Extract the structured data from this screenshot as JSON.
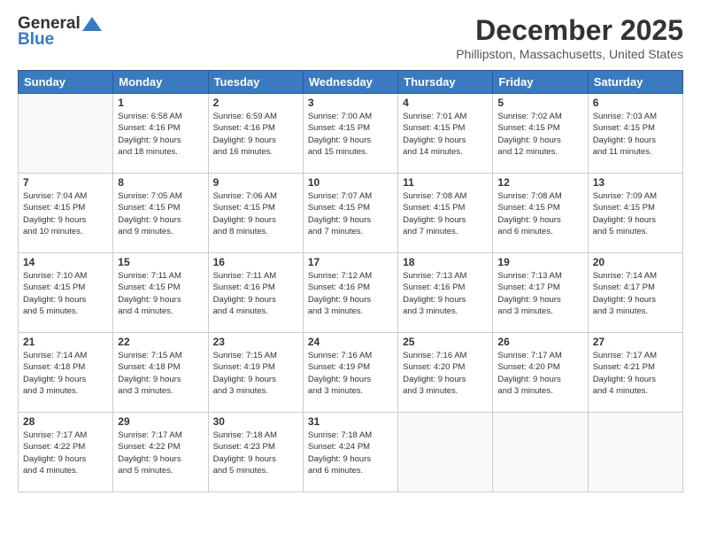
{
  "header": {
    "logo_general": "General",
    "logo_blue": "Blue",
    "month_title": "December 2025",
    "location": "Phillipston, Massachusetts, United States"
  },
  "weekdays": [
    "Sunday",
    "Monday",
    "Tuesday",
    "Wednesday",
    "Thursday",
    "Friday",
    "Saturday"
  ],
  "weeks": [
    [
      {
        "day": "",
        "info": ""
      },
      {
        "day": "1",
        "info": "Sunrise: 6:58 AM\nSunset: 4:16 PM\nDaylight: 9 hours\nand 18 minutes."
      },
      {
        "day": "2",
        "info": "Sunrise: 6:59 AM\nSunset: 4:16 PM\nDaylight: 9 hours\nand 16 minutes."
      },
      {
        "day": "3",
        "info": "Sunrise: 7:00 AM\nSunset: 4:15 PM\nDaylight: 9 hours\nand 15 minutes."
      },
      {
        "day": "4",
        "info": "Sunrise: 7:01 AM\nSunset: 4:15 PM\nDaylight: 9 hours\nand 14 minutes."
      },
      {
        "day": "5",
        "info": "Sunrise: 7:02 AM\nSunset: 4:15 PM\nDaylight: 9 hours\nand 12 minutes."
      },
      {
        "day": "6",
        "info": "Sunrise: 7:03 AM\nSunset: 4:15 PM\nDaylight: 9 hours\nand 11 minutes."
      }
    ],
    [
      {
        "day": "7",
        "info": "Sunrise: 7:04 AM\nSunset: 4:15 PM\nDaylight: 9 hours\nand 10 minutes."
      },
      {
        "day": "8",
        "info": "Sunrise: 7:05 AM\nSunset: 4:15 PM\nDaylight: 9 hours\nand 9 minutes."
      },
      {
        "day": "9",
        "info": "Sunrise: 7:06 AM\nSunset: 4:15 PM\nDaylight: 9 hours\nand 8 minutes."
      },
      {
        "day": "10",
        "info": "Sunrise: 7:07 AM\nSunset: 4:15 PM\nDaylight: 9 hours\nand 7 minutes."
      },
      {
        "day": "11",
        "info": "Sunrise: 7:08 AM\nSunset: 4:15 PM\nDaylight: 9 hours\nand 7 minutes."
      },
      {
        "day": "12",
        "info": "Sunrise: 7:08 AM\nSunset: 4:15 PM\nDaylight: 9 hours\nand 6 minutes."
      },
      {
        "day": "13",
        "info": "Sunrise: 7:09 AM\nSunset: 4:15 PM\nDaylight: 9 hours\nand 5 minutes."
      }
    ],
    [
      {
        "day": "14",
        "info": "Sunrise: 7:10 AM\nSunset: 4:15 PM\nDaylight: 9 hours\nand 5 minutes."
      },
      {
        "day": "15",
        "info": "Sunrise: 7:11 AM\nSunset: 4:15 PM\nDaylight: 9 hours\nand 4 minutes."
      },
      {
        "day": "16",
        "info": "Sunrise: 7:11 AM\nSunset: 4:16 PM\nDaylight: 9 hours\nand 4 minutes."
      },
      {
        "day": "17",
        "info": "Sunrise: 7:12 AM\nSunset: 4:16 PM\nDaylight: 9 hours\nand 3 minutes."
      },
      {
        "day": "18",
        "info": "Sunrise: 7:13 AM\nSunset: 4:16 PM\nDaylight: 9 hours\nand 3 minutes."
      },
      {
        "day": "19",
        "info": "Sunrise: 7:13 AM\nSunset: 4:17 PM\nDaylight: 9 hours\nand 3 minutes."
      },
      {
        "day": "20",
        "info": "Sunrise: 7:14 AM\nSunset: 4:17 PM\nDaylight: 9 hours\nand 3 minutes."
      }
    ],
    [
      {
        "day": "21",
        "info": "Sunrise: 7:14 AM\nSunset: 4:18 PM\nDaylight: 9 hours\nand 3 minutes."
      },
      {
        "day": "22",
        "info": "Sunrise: 7:15 AM\nSunset: 4:18 PM\nDaylight: 9 hours\nand 3 minutes."
      },
      {
        "day": "23",
        "info": "Sunrise: 7:15 AM\nSunset: 4:19 PM\nDaylight: 9 hours\nand 3 minutes."
      },
      {
        "day": "24",
        "info": "Sunrise: 7:16 AM\nSunset: 4:19 PM\nDaylight: 9 hours\nand 3 minutes."
      },
      {
        "day": "25",
        "info": "Sunrise: 7:16 AM\nSunset: 4:20 PM\nDaylight: 9 hours\nand 3 minutes."
      },
      {
        "day": "26",
        "info": "Sunrise: 7:17 AM\nSunset: 4:20 PM\nDaylight: 9 hours\nand 3 minutes."
      },
      {
        "day": "27",
        "info": "Sunrise: 7:17 AM\nSunset: 4:21 PM\nDaylight: 9 hours\nand 4 minutes."
      }
    ],
    [
      {
        "day": "28",
        "info": "Sunrise: 7:17 AM\nSunset: 4:22 PM\nDaylight: 9 hours\nand 4 minutes."
      },
      {
        "day": "29",
        "info": "Sunrise: 7:17 AM\nSunset: 4:22 PM\nDaylight: 9 hours\nand 5 minutes."
      },
      {
        "day": "30",
        "info": "Sunrise: 7:18 AM\nSunset: 4:23 PM\nDaylight: 9 hours\nand 5 minutes."
      },
      {
        "day": "31",
        "info": "Sunrise: 7:18 AM\nSunset: 4:24 PM\nDaylight: 9 hours\nand 6 minutes."
      },
      {
        "day": "",
        "info": ""
      },
      {
        "day": "",
        "info": ""
      },
      {
        "day": "",
        "info": ""
      }
    ]
  ]
}
